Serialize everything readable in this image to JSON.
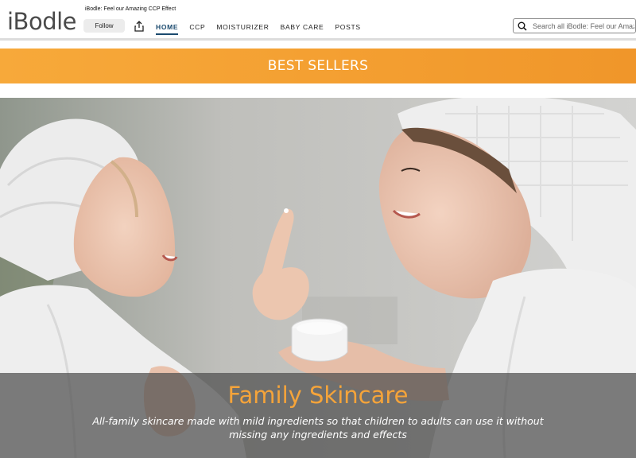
{
  "brand": {
    "logo_text": "iBodle",
    "tagline": "iBodle: Feel our Amazing CCP Effect"
  },
  "header": {
    "follow_label": "Follow",
    "share_icon": "share-icon",
    "nav": [
      {
        "label": "HOME",
        "active": true
      },
      {
        "label": "CCP",
        "active": false
      },
      {
        "label": "MOISTURIZER",
        "active": false
      },
      {
        "label": "BABY CARE",
        "active": false
      },
      {
        "label": "POSTS",
        "active": false
      }
    ],
    "search": {
      "icon": "search-icon",
      "placeholder": "Search all iBodle: Feel our Amazing CCP Effect"
    }
  },
  "banner": {
    "title": "BEST SELLERS",
    "color": "#f4a032"
  },
  "hero": {
    "title": "Family Skincare",
    "description": "All-family skincare made with mild ingredients so that children to adults can use it without missing any ingredients and effects",
    "title_color": "#f5a43a"
  },
  "colors": {
    "accent": "#1a4a6e",
    "banner": "#f4a032"
  }
}
